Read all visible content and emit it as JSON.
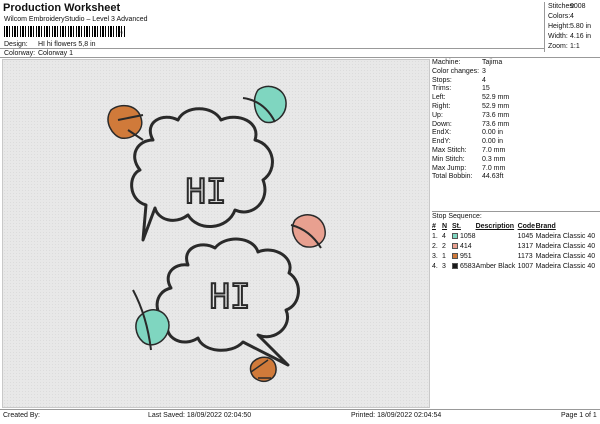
{
  "header": {
    "title": "Production Worksheet",
    "subtitle": "Wilcom EmbroideryStudio – Level 3 Advanced",
    "barcode_suffix": ","
  },
  "design": {
    "label": "Design:",
    "value": "HI hi flowers 5,8 in"
  },
  "colorway": {
    "label": "Colorway:",
    "value": "Colorway 1"
  },
  "stats": [
    {
      "label": "Stitches:",
      "value": "9008"
    },
    {
      "label": "Colors:",
      "value": "4"
    },
    {
      "label": "Height:",
      "value": "5.80 in"
    },
    {
      "label": "Width:",
      "value": "4.16 in"
    },
    {
      "label": "Zoom:",
      "value": "1:1"
    }
  ],
  "machine_info": [
    {
      "label": "Machine:",
      "value": "Tajima"
    },
    {
      "label": "Color changes:",
      "value": "3"
    },
    {
      "label": "Stops:",
      "value": "4"
    },
    {
      "label": "Trims:",
      "value": "15"
    },
    {
      "label": "Left:",
      "value": "52.9 mm"
    },
    {
      "label": "Right:",
      "value": "52.9 mm"
    },
    {
      "label": "Up:",
      "value": "73.6 mm"
    },
    {
      "label": "Down:",
      "value": "73.6 mm"
    },
    {
      "label": "EndX:",
      "value": "0.00 in"
    },
    {
      "label": "EndY:",
      "value": "0.00 in"
    },
    {
      "label": "Max Stitch:",
      "value": "7.0 mm"
    },
    {
      "label": "Min Stitch:",
      "value": "0.3 mm"
    },
    {
      "label": "Max Jump:",
      "value": "7.0 mm"
    },
    {
      "label": "Total Bobbin:",
      "value": "44.63ft"
    }
  ],
  "stop_sequence": {
    "title": "Stop Sequence:",
    "columns": [
      "#",
      "N",
      "St.",
      "Description",
      "Code",
      "Brand"
    ],
    "rows": [
      {
        "num": "1.",
        "n": "4",
        "color": "#7fd6c0",
        "st": "1058",
        "desc": "",
        "code": "1045",
        "brand": "Madeira Classic 40"
      },
      {
        "num": "2.",
        "n": "2",
        "color": "#e8a090",
        "st": "414",
        "desc": "",
        "code": "1317",
        "brand": "Madeira Classic 40"
      },
      {
        "num": "3.",
        "n": "1",
        "color": "#d07a3a",
        "st": "951",
        "desc": "",
        "code": "1173",
        "brand": "Madeira Classic 40"
      },
      {
        "num": "4.",
        "n": "3",
        "color": "#1a1a1a",
        "st": "6583",
        "desc": "Amber Black",
        "code": "1007",
        "brand": "Madeira Classic 40"
      }
    ]
  },
  "design_text": {
    "top": "HI",
    "bottom": "HI"
  },
  "footer": {
    "created_by": "Created By:",
    "last_saved": "Last Saved: 18/09/2022 02:04:50",
    "printed": "Printed: 18/09/2022 02:04:54",
    "page": "Page 1 of 1"
  },
  "colors": {
    "teal": "#7fd6c0",
    "salmon": "#e8a090",
    "orange": "#d07a3a",
    "black": "#1a1a1a"
  }
}
